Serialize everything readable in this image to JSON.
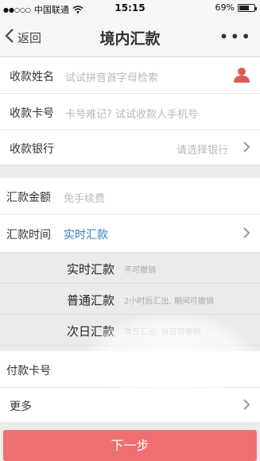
{
  "status_bar": {
    "signal": "●●○○○",
    "carrier": "中国联通",
    "time": "15:15",
    "battery_text": "69%",
    "battery_level": 0.69
  },
  "nav": {
    "back_label": "返回",
    "title": "境内汇款",
    "more_label": "•••"
  },
  "form": {
    "payee_name": {
      "label": "收款姓名",
      "placeholder": "试试拼音首字母检索"
    },
    "payee_card": {
      "label": "收款卡号",
      "placeholder": "卡号难记? 试试收款人手机号"
    },
    "payee_bank": {
      "label": "收款银行",
      "placeholder": "请选择银行"
    },
    "amount": {
      "label": "汇款金额",
      "placeholder": "免手续费"
    },
    "transfer_time": {
      "label": "汇款时间",
      "value": "实时汇款"
    },
    "pay_card": {
      "label": "付款卡号"
    },
    "more": {
      "label": "更多"
    }
  },
  "time_options": [
    {
      "name": "实时汇款",
      "desc": "不可撤销"
    },
    {
      "name": "普通汇款",
      "desc": "2小时后汇出, 期间可撤销"
    },
    {
      "name": "次日汇款",
      "desc": "次日汇出, 当日可撤销"
    }
  ],
  "next_button": "下一步",
  "colors": {
    "accent_blue": "#2a7fbf",
    "button_red": "#ef6e70",
    "person_icon_red": "#e05a5a"
  }
}
